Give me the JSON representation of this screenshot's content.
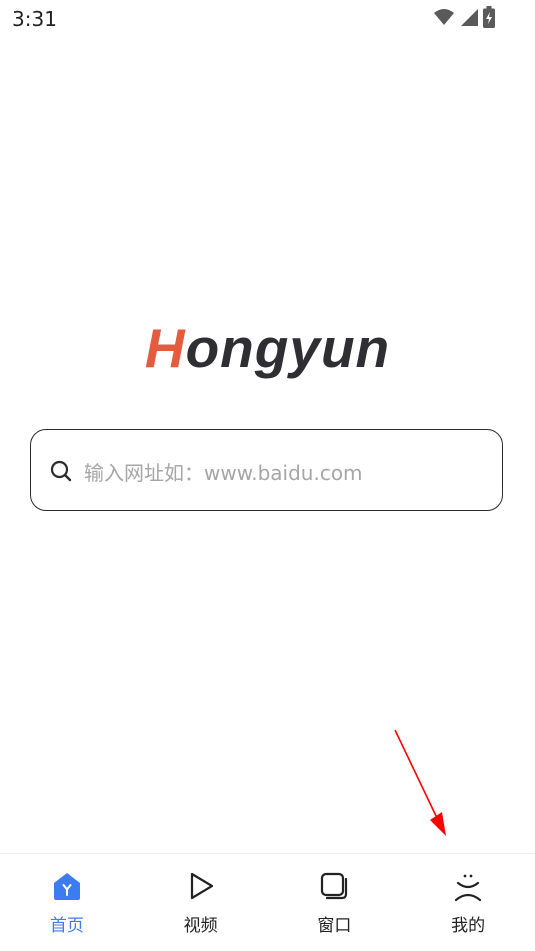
{
  "status_bar": {
    "time": "3:31",
    "icons": [
      "wifi-icon",
      "cellular-signal-icon",
      "battery-charging-icon"
    ]
  },
  "logo": {
    "first_letter": "H",
    "rest": "ongyun",
    "first_letter_color": "#e35c3e",
    "rest_color": "#2f2f33"
  },
  "search": {
    "placeholder": "输入网址如：www.baidu.com",
    "icon": "search-icon"
  },
  "bottom_nav": {
    "active_color": "#3d7cf0",
    "items": [
      {
        "label": "首页",
        "icon": "home-icon",
        "active": true
      },
      {
        "label": "视频",
        "icon": "play-icon",
        "active": false
      },
      {
        "label": "窗口",
        "icon": "windows-icon",
        "active": false
      },
      {
        "label": "我的",
        "icon": "profile-icon",
        "active": false
      }
    ]
  },
  "annotation": {
    "color": "#ff0000",
    "icon": "red-arrow-pointer"
  }
}
